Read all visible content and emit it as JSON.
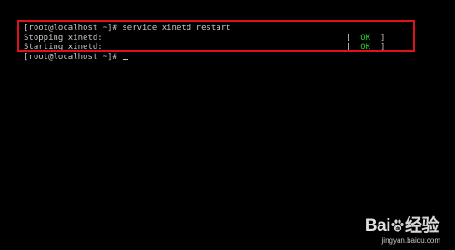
{
  "terminal": {
    "lines": [
      "[root@localhost ~]# service xinetd restart",
      "Stopping xinetd:",
      "Starting xinetd:",
      "[root@localhost ~]# "
    ],
    "status": [
      {
        "open": "[  ",
        "ok": "OK",
        "close": "  ]"
      },
      {
        "open": "[  ",
        "ok": "OK",
        "close": "  ]"
      }
    ]
  },
  "watermark": {
    "brand_left": "Bai",
    "brand_right": "经验",
    "url": "jingyan.baidu.com"
  },
  "colors": {
    "background": "#000000",
    "text": "#c8c8c8",
    "ok": "#22d022",
    "highlight": "#e0101e"
  }
}
